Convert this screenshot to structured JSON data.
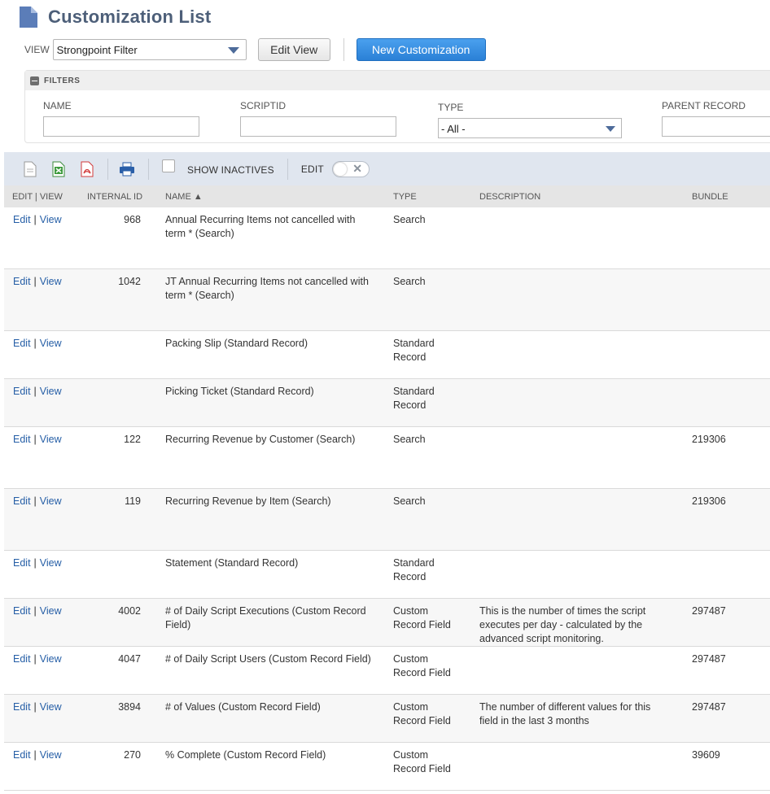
{
  "page": {
    "title": "Customization List"
  },
  "view": {
    "label": "VIEW",
    "selected": "Strongpoint Filter",
    "edit_view_label": "Edit View",
    "new_label": "New Customization"
  },
  "filters": {
    "title": "FILTERS",
    "name_label": "NAME",
    "scriptid_label": "SCRIPTID",
    "type_label": "TYPE",
    "type_selected": "- All -",
    "parent_label": "PARENT RECORD"
  },
  "toolbar": {
    "show_inactives_label": "SHOW INACTIVES",
    "edit_label": "EDIT"
  },
  "table": {
    "headers": {
      "editview": "EDIT | VIEW",
      "internal_id": "INTERNAL ID",
      "name": "NAME ▲",
      "type": "TYPE",
      "description": "DESCRIPTION",
      "bundle": "BUNDLE"
    },
    "edit_label": "Edit",
    "view_label": "View",
    "rows": [
      {
        "id": "968",
        "name": "Annual Recurring Items not cancelled with term * (Search)",
        "type": "Search",
        "description": "",
        "bundle": ""
      },
      {
        "id": "1042",
        "name": "JT Annual Recurring Items not cancelled with term * (Search)",
        "type": "Search",
        "description": "",
        "bundle": ""
      },
      {
        "id": "",
        "name": "Packing Slip (Standard Record)",
        "type": "Standard Record",
        "description": "",
        "bundle": ""
      },
      {
        "id": "",
        "name": "Picking Ticket (Standard Record)",
        "type": "Standard Record",
        "description": "",
        "bundle": ""
      },
      {
        "id": "122",
        "name": "Recurring Revenue by Customer (Search)",
        "type": "Search",
        "description": "",
        "bundle": "219306"
      },
      {
        "id": "119",
        "name": "Recurring Revenue by Item (Search)",
        "type": "Search",
        "description": "",
        "bundle": "219306"
      },
      {
        "id": "",
        "name": "Statement (Standard Record)",
        "type": "Standard Record",
        "description": "",
        "bundle": ""
      },
      {
        "id": "4002",
        "name": "# of Daily Script Executions (Custom Record Field)",
        "type": "Custom Record Field",
        "description": "This is the number of times the script executes per day - calculated by the advanced script monitoring.",
        "bundle": "297487"
      },
      {
        "id": "4047",
        "name": "# of Daily Script Users (Custom Record Field)",
        "type": "Custom Record Field",
        "description": "",
        "bundle": "297487"
      },
      {
        "id": "3894",
        "name": "# of Values (Custom Record Field)",
        "type": "Custom Record Field",
        "description": "The number of different values for this field in the last 3 months",
        "bundle": "297487"
      },
      {
        "id": "270",
        "name": "% Complete (Custom Record Field)",
        "type": "Custom Record Field",
        "description": "",
        "bundle": "39609"
      }
    ]
  }
}
